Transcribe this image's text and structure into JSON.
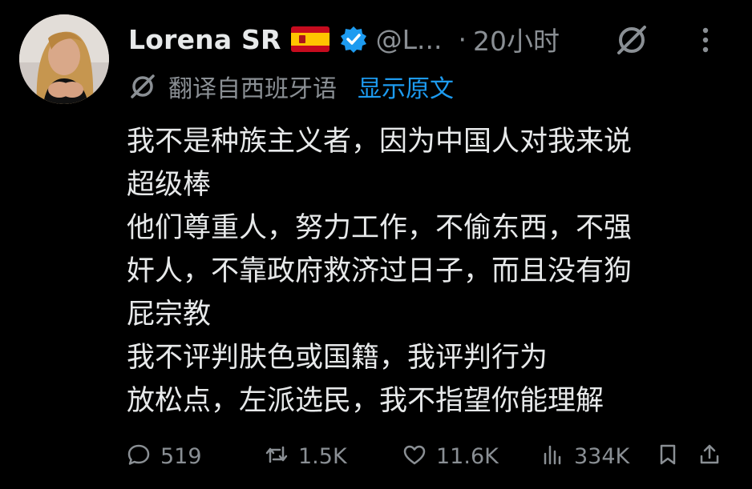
{
  "author": {
    "display_name": "Lorena SR",
    "flag": "🇪🇸",
    "handle": "@L...",
    "separator": "·",
    "time": "20小时"
  },
  "translation": {
    "label": "翻译自西班牙语",
    "link": "显示原文"
  },
  "tweet_lines": [
    "我不是种族主义者，因为中国人对我来说",
    "超级棒",
    "他们尊重人，努力工作，不偷东西，不强",
    "奸人，不靠政府救济过日子，而且没有狗",
    "屁宗教",
    "我不评判肤色或国籍，我评判行为",
    "放松点，左派选民，我不指望你能理解"
  ],
  "stats": {
    "replies": "519",
    "retweets": "1.5K",
    "likes": "11.6K",
    "views": "334K"
  },
  "colors": {
    "background": "#000000",
    "text": "#e7e9ea",
    "muted": "#8a8f94",
    "link": "#1d9bf0",
    "verified": "#1d9bf0"
  },
  "icons": [
    "grok-icon",
    "more-icon",
    "translate-icon",
    "reply-icon",
    "retweet-icon",
    "like-icon",
    "views-icon",
    "bookmark-icon",
    "share-icon"
  ]
}
